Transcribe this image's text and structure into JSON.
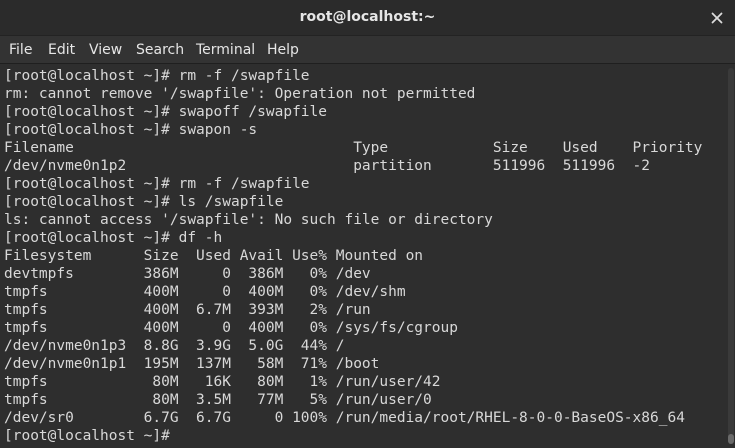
{
  "window": {
    "title": "root@localhost:~"
  },
  "menubar": {
    "items": [
      "File",
      "Edit",
      "View",
      "Search",
      "Terminal",
      "Help"
    ]
  },
  "terminal": {
    "lines": [
      "[root@localhost ~]# rm -f /swapfile",
      "rm: cannot remove '/swapfile': Operation not permitted",
      "[root@localhost ~]# swapoff /swapfile",
      "[root@localhost ~]# swapon -s",
      "Filename                                Type            Size    Used    Priority",
      "/dev/nvme0n1p2                          partition       511996  511996  -2",
      "[root@localhost ~]# rm -f /swapfile",
      "[root@localhost ~]# ls /swapfile",
      "ls: cannot access '/swapfile': No such file or directory",
      "[root@localhost ~]# df -h",
      "Filesystem      Size  Used Avail Use% Mounted on",
      "devtmpfs        386M     0  386M   0% /dev",
      "tmpfs           400M     0  400M   0% /dev/shm",
      "tmpfs           400M  6.7M  393M   2% /run",
      "tmpfs           400M     0  400M   0% /sys/fs/cgroup",
      "/dev/nvme0n1p3  8.8G  3.9G  5.0G  44% /",
      "/dev/nvme0n1p1  195M  137M   58M  71% /boot",
      "tmpfs            80M   16K   80M   1% /run/user/42",
      "tmpfs            80M  3.5M   77M   5% /run/user/0",
      "/dev/sr0        6.7G  6.7G     0 100% /run/media/root/RHEL-8-0-0-BaseOS-x86_64",
      "[root@localhost ~]# "
    ]
  },
  "icons": {
    "close": "close-icon"
  },
  "colors": {
    "titlebar_bg": "#2b2b2b",
    "menubar_bg": "#333333",
    "terminal_bg": "#2e2e2e",
    "terminal_fg": "#d8d8d8"
  }
}
